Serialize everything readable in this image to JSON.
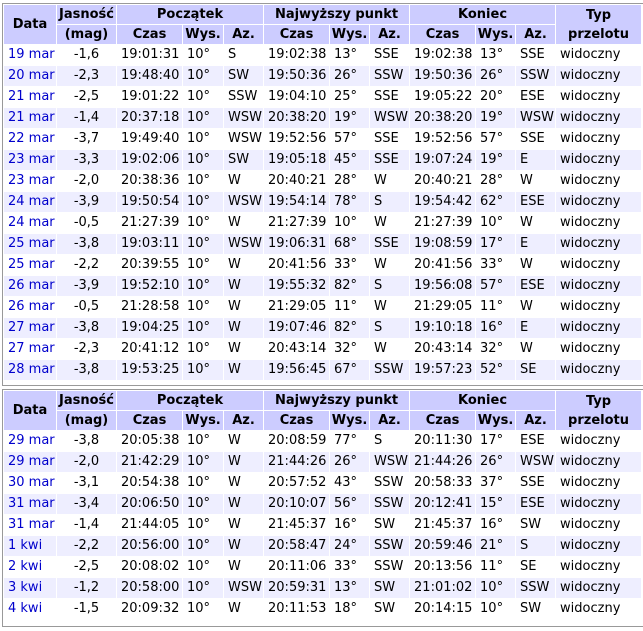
{
  "headers": {
    "date": "Data",
    "magnitude_line1": "Jasność",
    "magnitude_line2": "(mag)",
    "start": "Początek",
    "highest": "Najwyższy punkt",
    "end": "Koniec",
    "pass_type": "Typ przelotu",
    "time": "Czas",
    "alt": "Wys.",
    "az": "Az."
  },
  "table1": [
    {
      "date": "19 mar",
      "mag": "-1,6",
      "s_time": "19:01:31",
      "s_alt": "10°",
      "s_az": "S",
      "h_time": "19:02:38",
      "h_alt": "13°",
      "h_az": "SSE",
      "e_time": "19:02:38",
      "e_alt": "13°",
      "e_az": "SSE",
      "type": "widoczny"
    },
    {
      "date": "20 mar",
      "mag": "-2,3",
      "s_time": "19:48:40",
      "s_alt": "10°",
      "s_az": "SW",
      "h_time": "19:50:36",
      "h_alt": "26°",
      "h_az": "SSW",
      "e_time": "19:50:36",
      "e_alt": "26°",
      "e_az": "SSW",
      "type": "widoczny"
    },
    {
      "date": "21 mar",
      "mag": "-2,5",
      "s_time": "19:01:22",
      "s_alt": "10°",
      "s_az": "SSW",
      "h_time": "19:04:10",
      "h_alt": "25°",
      "h_az": "SSE",
      "e_time": "19:05:22",
      "e_alt": "20°",
      "e_az": "ESE",
      "type": "widoczny"
    },
    {
      "date": "21 mar",
      "mag": "-1,4",
      "s_time": "20:37:18",
      "s_alt": "10°",
      "s_az": "WSW",
      "h_time": "20:38:20",
      "h_alt": "19°",
      "h_az": "WSW",
      "e_time": "20:38:20",
      "e_alt": "19°",
      "e_az": "WSW",
      "type": "widoczny"
    },
    {
      "date": "22 mar",
      "mag": "-3,7",
      "s_time": "19:49:40",
      "s_alt": "10°",
      "s_az": "WSW",
      "h_time": "19:52:56",
      "h_alt": "57°",
      "h_az": "SSE",
      "e_time": "19:52:56",
      "e_alt": "57°",
      "e_az": "SSE",
      "type": "widoczny"
    },
    {
      "date": "23 mar",
      "mag": "-3,3",
      "s_time": "19:02:06",
      "s_alt": "10°",
      "s_az": "SW",
      "h_time": "19:05:18",
      "h_alt": "45°",
      "h_az": "SSE",
      "e_time": "19:07:24",
      "e_alt": "19°",
      "e_az": "E",
      "type": "widoczny"
    },
    {
      "date": "23 mar",
      "mag": "-2,0",
      "s_time": "20:38:36",
      "s_alt": "10°",
      "s_az": "W",
      "h_time": "20:40:21",
      "h_alt": "28°",
      "h_az": "W",
      "e_time": "20:40:21",
      "e_alt": "28°",
      "e_az": "W",
      "type": "widoczny"
    },
    {
      "date": "24 mar",
      "mag": "-3,9",
      "s_time": "19:50:54",
      "s_alt": "10°",
      "s_az": "WSW",
      "h_time": "19:54:14",
      "h_alt": "78°",
      "h_az": "S",
      "e_time": "19:54:42",
      "e_alt": "62°",
      "e_az": "ESE",
      "type": "widoczny"
    },
    {
      "date": "24 mar",
      "mag": "-0,5",
      "s_time": "21:27:39",
      "s_alt": "10°",
      "s_az": "W",
      "h_time": "21:27:39",
      "h_alt": "10°",
      "h_az": "W",
      "e_time": "21:27:39",
      "e_alt": "10°",
      "e_az": "W",
      "type": "widoczny"
    },
    {
      "date": "25 mar",
      "mag": "-3,8",
      "s_time": "19:03:11",
      "s_alt": "10°",
      "s_az": "WSW",
      "h_time": "19:06:31",
      "h_alt": "68°",
      "h_az": "SSE",
      "e_time": "19:08:59",
      "e_alt": "17°",
      "e_az": "E",
      "type": "widoczny"
    },
    {
      "date": "25 mar",
      "mag": "-2,2",
      "s_time": "20:39:55",
      "s_alt": "10°",
      "s_az": "W",
      "h_time": "20:41:56",
      "h_alt": "33°",
      "h_az": "W",
      "e_time": "20:41:56",
      "e_alt": "33°",
      "e_az": "W",
      "type": "widoczny"
    },
    {
      "date": "26 mar",
      "mag": "-3,9",
      "s_time": "19:52:10",
      "s_alt": "10°",
      "s_az": "W",
      "h_time": "19:55:32",
      "h_alt": "82°",
      "h_az": "S",
      "e_time": "19:56:08",
      "e_alt": "57°",
      "e_az": "ESE",
      "type": "widoczny"
    },
    {
      "date": "26 mar",
      "mag": "-0,5",
      "s_time": "21:28:58",
      "s_alt": "10°",
      "s_az": "W",
      "h_time": "21:29:05",
      "h_alt": "11°",
      "h_az": "W",
      "e_time": "21:29:05",
      "e_alt": "11°",
      "e_az": "W",
      "type": "widoczny"
    },
    {
      "date": "27 mar",
      "mag": "-3,8",
      "s_time": "19:04:25",
      "s_alt": "10°",
      "s_az": "W",
      "h_time": "19:07:46",
      "h_alt": "82°",
      "h_az": "S",
      "e_time": "19:10:18",
      "e_alt": "16°",
      "e_az": "E",
      "type": "widoczny"
    },
    {
      "date": "27 mar",
      "mag": "-2,3",
      "s_time": "20:41:12",
      "s_alt": "10°",
      "s_az": "W",
      "h_time": "20:43:14",
      "h_alt": "32°",
      "h_az": "W",
      "e_time": "20:43:14",
      "e_alt": "32°",
      "e_az": "W",
      "type": "widoczny"
    },
    {
      "date": "28 mar",
      "mag": "-3,8",
      "s_time": "19:53:25",
      "s_alt": "10°",
      "s_az": "W",
      "h_time": "19:56:45",
      "h_alt": "67°",
      "h_az": "SSW",
      "e_time": "19:57:23",
      "e_alt": "52°",
      "e_az": "SE",
      "type": "widoczny"
    }
  ],
  "table2": [
    {
      "date": "29 mar",
      "mag": "-3,8",
      "s_time": "20:05:38",
      "s_alt": "10°",
      "s_az": "W",
      "h_time": "20:08:59",
      "h_alt": "77°",
      "h_az": "S",
      "e_time": "20:11:30",
      "e_alt": "17°",
      "e_az": "ESE",
      "type": "widoczny"
    },
    {
      "date": "29 mar",
      "mag": "-2,0",
      "s_time": "21:42:29",
      "s_alt": "10°",
      "s_az": "W",
      "h_time": "21:44:26",
      "h_alt": "26°",
      "h_az": "WSW",
      "e_time": "21:44:26",
      "e_alt": "26°",
      "e_az": "WSW",
      "type": "widoczny"
    },
    {
      "date": "30 mar",
      "mag": "-3,1",
      "s_time": "20:54:38",
      "s_alt": "10°",
      "s_az": "W",
      "h_time": "20:57:52",
      "h_alt": "43°",
      "h_az": "SSW",
      "e_time": "20:58:33",
      "e_alt": "37°",
      "e_az": "SSE",
      "type": "widoczny"
    },
    {
      "date": "31 mar",
      "mag": "-3,4",
      "s_time": "20:06:50",
      "s_alt": "10°",
      "s_az": "W",
      "h_time": "20:10:07",
      "h_alt": "56°",
      "h_az": "SSW",
      "e_time": "20:12:41",
      "e_alt": "15°",
      "e_az": "ESE",
      "type": "widoczny"
    },
    {
      "date": "31 mar",
      "mag": "-1,4",
      "s_time": "21:44:05",
      "s_alt": "10°",
      "s_az": "W",
      "h_time": "21:45:37",
      "h_alt": "16°",
      "h_az": "SW",
      "e_time": "21:45:37",
      "e_alt": "16°",
      "e_az": "SW",
      "type": "widoczny"
    },
    {
      "date": "1 kwi",
      "mag": "-2,2",
      "s_time": "20:56:00",
      "s_alt": "10°",
      "s_az": "W",
      "h_time": "20:58:47",
      "h_alt": "24°",
      "h_az": "SSW",
      "e_time": "20:59:46",
      "e_alt": "21°",
      "e_az": "S",
      "type": "widoczny"
    },
    {
      "date": "2 kwi",
      "mag": "-2,5",
      "s_time": "20:08:02",
      "s_alt": "10°",
      "s_az": "W",
      "h_time": "20:11:06",
      "h_alt": "33°",
      "h_az": "SSW",
      "e_time": "20:13:56",
      "e_alt": "11°",
      "e_az": "SE",
      "type": "widoczny"
    },
    {
      "date": "3 kwi",
      "mag": "-1,2",
      "s_time": "20:58:00",
      "s_alt": "10°",
      "s_az": "WSW",
      "h_time": "20:59:31",
      "h_alt": "13°",
      "h_az": "SW",
      "e_time": "21:01:02",
      "e_alt": "10°",
      "e_az": "SSW",
      "type": "widoczny"
    },
    {
      "date": "4 kwi",
      "mag": "-1,5",
      "s_time": "20:09:32",
      "s_alt": "10°",
      "s_az": "W",
      "h_time": "20:11:53",
      "h_alt": "18°",
      "h_az": "SW",
      "e_time": "20:14:15",
      "e_alt": "10°",
      "e_az": "SW",
      "type": "widoczny"
    }
  ]
}
